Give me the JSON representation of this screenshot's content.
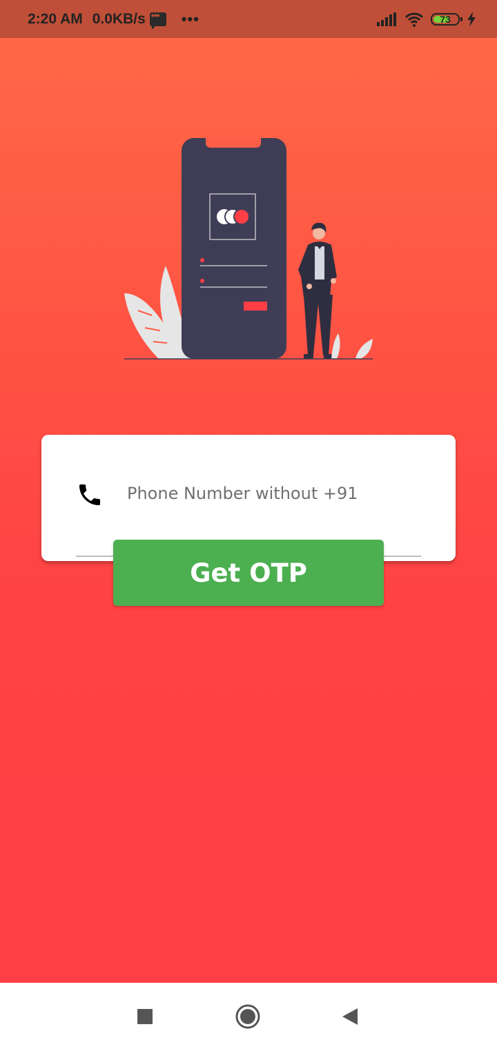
{
  "status_bar": {
    "time": "2:20 AM",
    "speed": "0.0KB/s",
    "more": "•••",
    "battery_level": "73",
    "battery_fraction": 0.73,
    "icons": [
      "message-icon",
      "signal-icon",
      "wifi-icon",
      "battery-icon",
      "charging-icon"
    ]
  },
  "login": {
    "phone_placeholder": "Phone Number without +91",
    "phone_value": "",
    "phone_icon": "phone-icon",
    "otp_button_label": "Get OTP"
  },
  "nav_bar": {
    "items": [
      "recents-button",
      "home-button",
      "back-button"
    ]
  },
  "colors": {
    "status_bar": "#bf4f38",
    "gradient_top": "#ff6846",
    "gradient_bottom": "#ff3f45",
    "button": "#4caf50",
    "phone_body": "#3f3d56",
    "accent": "#ff3f45"
  }
}
